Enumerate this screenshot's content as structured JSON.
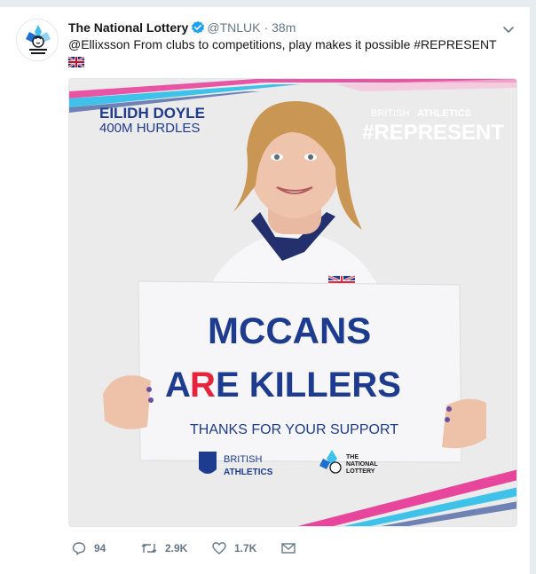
{
  "tweet": {
    "name": "The National Lottery",
    "handle": "@TNLUK",
    "dot": "·",
    "time": "38m",
    "text": "@Ellixsson From clubs to competitions, play makes it possible #REPRESENT",
    "flag_icon": "uk-flag-icon"
  },
  "media": {
    "athlete_name": "EILIDH DOYLE",
    "athlete_event": "400M HURDLES",
    "brand_top_left": "BRITISH",
    "brand_top_right": "ATHLETICS",
    "hashtag": "#REPRESENT",
    "sign_line1": "MCCANS",
    "sign_line2_a": "A",
    "sign_line2_b": "R",
    "sign_line2_c": "E KILLERS",
    "sign_line3": "THANKS FOR YOUR SUPPORT",
    "sign_logo_left_1": "BRITISH",
    "sign_logo_left_2": "ATHLETICS",
    "sign_logo_right_1": "THE",
    "sign_logo_right_2": "NATIONAL",
    "sign_logo_right_3": "LOTTERY",
    "colors": {
      "sign_blue": "#1d3c8f",
      "sign_red": "#e8233c",
      "pink": "#e8459c",
      "cyan": "#3ec2ea"
    }
  },
  "actions": {
    "replies": "94",
    "retweets": "2.9K",
    "likes": "1.7K"
  },
  "colors": {
    "link": "#1da1f2",
    "muted": "#657786",
    "verified": "#1da1f2"
  }
}
